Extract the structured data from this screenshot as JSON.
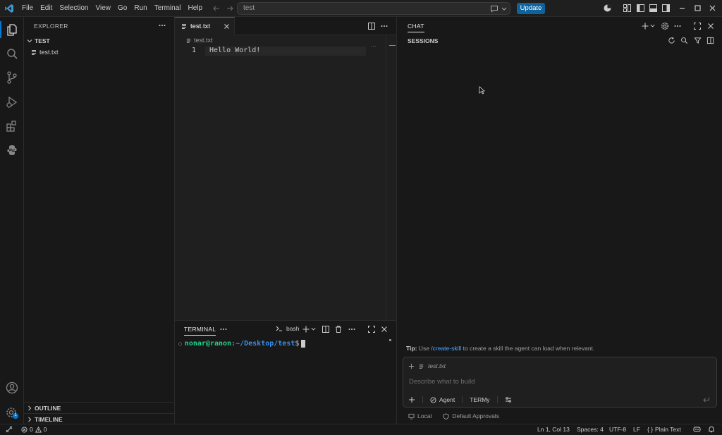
{
  "titlebar": {
    "menu": [
      "File",
      "Edit",
      "Selection",
      "View",
      "Go",
      "Run",
      "Terminal",
      "Help"
    ],
    "search_text": "test",
    "update_label": "Update"
  },
  "sidebar": {
    "header": "EXPLORER",
    "folder": "TEST",
    "file": "test.txt",
    "outline": "OUTLINE",
    "timeline": "TIMELINE"
  },
  "editor": {
    "tab_label": "test.txt",
    "breadcrumb": "test.txt",
    "line_number": "1",
    "line_text": "Hello World!"
  },
  "panel": {
    "tab": "TERMINAL",
    "shell": "bash",
    "prompt_user": "nonar@ranon",
    "prompt_path": ":~/Desktop/test",
    "prompt_symbol": "$"
  },
  "chat": {
    "title": "CHAT",
    "sessions": "SESSIONS",
    "tip_label": "Tip:",
    "tip_pre": " Use ",
    "tip_link": "/create-skill",
    "tip_post": " to create a skill the agent can load when relevant.",
    "attachment": "test.txt",
    "placeholder": "Describe what to build",
    "mode": "Agent",
    "model": "TERMy",
    "location": "Local",
    "approvals": "Default Approvals"
  },
  "status": {
    "errors": "0",
    "warnings": "0",
    "position": "Ln 1, Col 13",
    "spaces": "Spaces: 4",
    "encoding": "UTF-8",
    "eol": "LF",
    "language": "Plain Text",
    "badge": "1"
  },
  "colors": {
    "accent": "#0078d4",
    "update_button": "#0e639c",
    "prompt_green": "#23d18b",
    "prompt_blue": "#3b8eea"
  }
}
